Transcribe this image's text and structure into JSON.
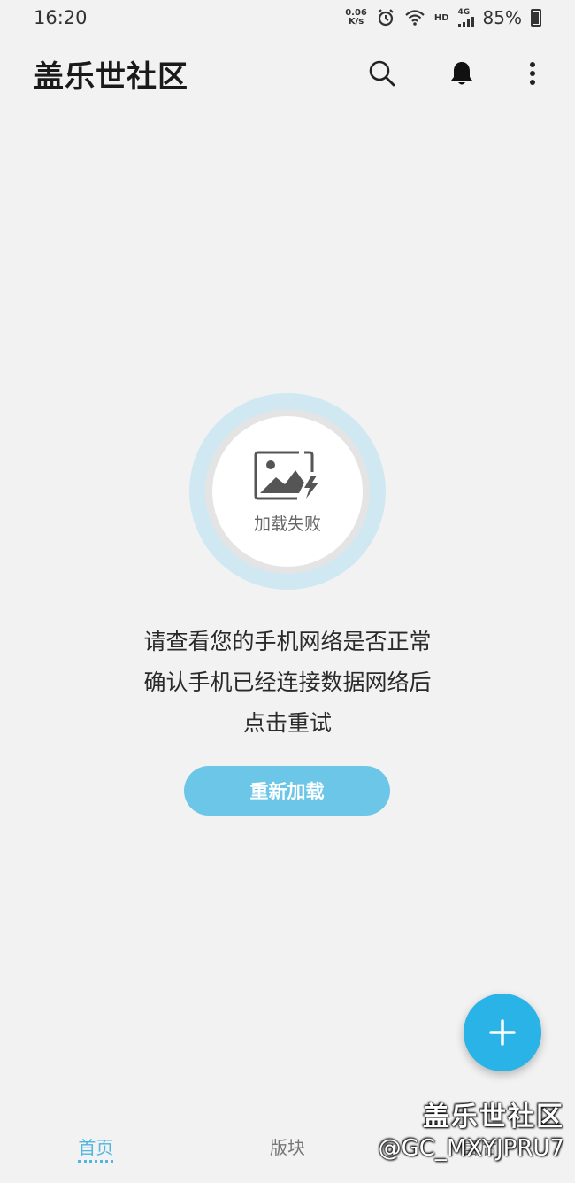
{
  "status_bar": {
    "time": "16:20",
    "net_speed_value": "0.06",
    "net_speed_unit": "K/s",
    "network_label": "HD",
    "network_type": "4G",
    "battery": "85%"
  },
  "header": {
    "title": "盖乐世社区"
  },
  "error": {
    "image_label": "加载失败",
    "message_lines": [
      "请查看您的手机网络是否正常",
      "确认手机已经连接数据网络后",
      "点击重试"
    ],
    "reload_label": "重新加载"
  },
  "bottom_nav": {
    "items": [
      {
        "label": "首页",
        "active": true
      },
      {
        "label": "版块",
        "active": false
      },
      {
        "label": "售后",
        "active": false
      }
    ]
  },
  "watermark": {
    "line1": "盖乐世社区",
    "line2": "@GC_MXYJPRU7"
  },
  "colors": {
    "accent": "#29b3e6",
    "reload_button": "#6cc6e8",
    "background": "#f2f2f2"
  }
}
